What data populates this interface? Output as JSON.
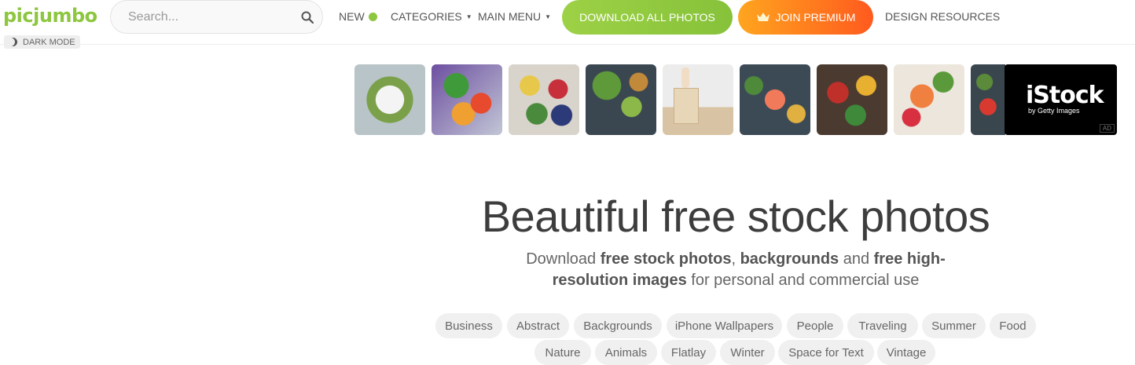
{
  "header": {
    "logo": "picjumbo",
    "dark_mode_label": "DARK MODE",
    "search": {
      "placeholder": "Search..."
    },
    "nav": {
      "new_label": "NEW",
      "categories_label": "CATEGORIES",
      "main_menu_label": "MAIN MENU",
      "download_label": "DOWNLOAD ALL PHOTOS",
      "premium_label": "JOIN PREMIUM",
      "design_resources_label": "DESIGN RESOURCES"
    }
  },
  "ad_banner": {
    "thumbnails": [
      "salad-bowl",
      "fruit-heart",
      "healthy-food-bowls",
      "vegetables-avocado",
      "medical-blocks",
      "salmon-vegetables",
      "heart-bowls",
      "fruit-salad",
      "food-board"
    ],
    "brand": "iStock",
    "brand_sub": "by Getty Images",
    "ad_label": "AD"
  },
  "hero": {
    "title": "Beautiful free stock photos",
    "subtitle": {
      "p1": "Download ",
      "b1": "free stock photos",
      "p2": ", ",
      "b2": "backgrounds",
      "p3": " and ",
      "b3": "free high-resolution images",
      "p4": " for personal and commercial use"
    }
  },
  "tags": [
    "Business",
    "Abstract",
    "Backgrounds",
    "iPhone Wallpapers",
    "People",
    "Traveling",
    "Summer",
    "Food",
    "Nature",
    "Animals",
    "Flatlay",
    "Winter",
    "Space for Text",
    "Vintage"
  ],
  "colors": {
    "brand_green": "#8dc63f",
    "premium_orange": "#ff8c1e",
    "text_dark": "#3d3d3d"
  }
}
